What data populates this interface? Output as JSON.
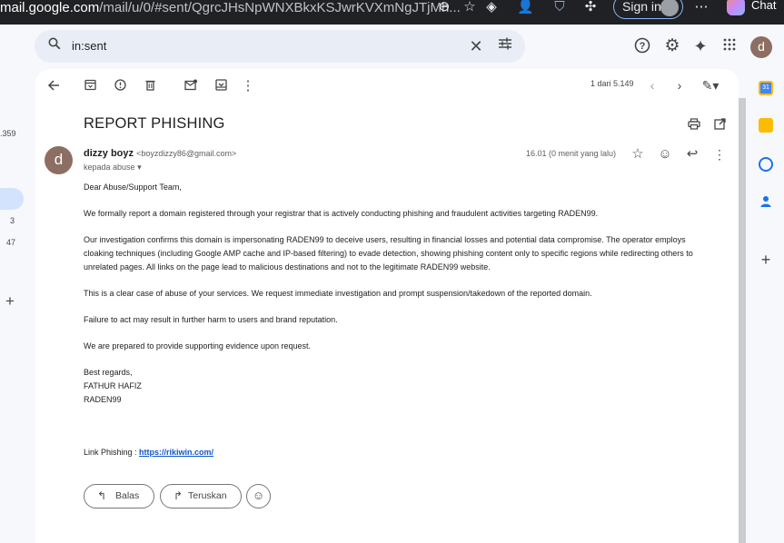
{
  "browser": {
    "url_domain": "mail.google.com",
    "url_path": "/mail/u/0/#sent/QgrcJHsNpWNXBkxKSJwrKVXmNgJTjMh...",
    "signin_label": "Sign in",
    "chat_label": "Chat"
  },
  "header": {
    "search_query": "in:sent",
    "avatar_letter": "d"
  },
  "left_rail": {
    "count_1": ".359",
    "count_2": "3",
    "count_3": "47",
    "add_symbol": "+"
  },
  "toolbar": {
    "counter": "1 dari 5.149"
  },
  "email": {
    "subject": "REPORT PHISHING",
    "sender_name": "dizzy boyz",
    "sender_email": "<boyzdizzy86@gmail.com>",
    "recipient": "kepada abuse",
    "time": "16.01 (0 menit yang lalu)",
    "avatar_letter": "d",
    "greeting": "Dear Abuse/Support Team,",
    "para1": "We formally report a domain registered through your registrar that is actively conducting phishing and fraudulent activities targeting RADEN99.",
    "para2": "Our investigation confirms this domain is impersonating RADEN99 to deceive users, resulting in financial losses and potential data compromise. The operator employs cloaking techniques (including Google AMP cache and IP-based filtering) to evade detection, showing phishing content only to specific regions while redirecting others to unrelated pages. All links on the page lead to malicious destinations and not to the legitimate RADEN99 website.",
    "para3": "This is a clear case of abuse of your services. We request immediate investigation and prompt suspension/takedown of the reported domain.",
    "para4": "Failure to act may result in further harm to users and brand reputation.",
    "para5": "We are prepared to provide supporting evidence upon request.",
    "signoff": "Best regards,",
    "sig_name": "FATHUR HAFIZ",
    "sig_org": "RADEN99",
    "link_label": "Link Phishing : ",
    "link_url": "https://rikiwin.com/"
  },
  "actions": {
    "reply_label": "Balas",
    "forward_label": "Teruskan"
  },
  "colors": {
    "accent": "#0b57d0",
    "avatar": "#8d6e63",
    "link": "#1155cc"
  }
}
